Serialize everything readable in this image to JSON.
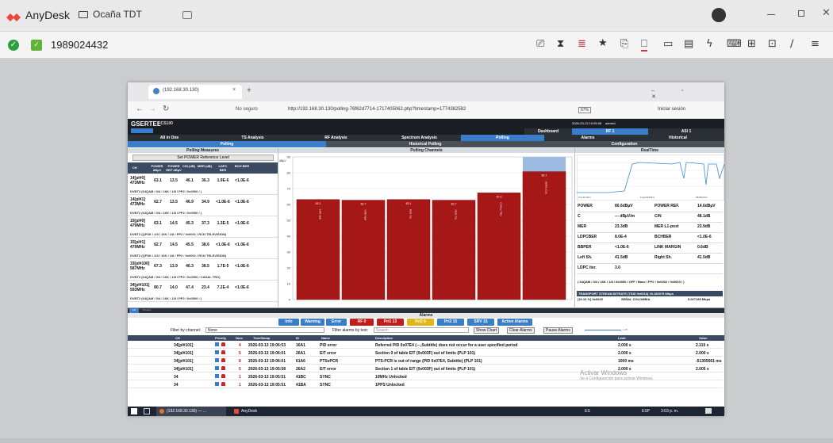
{
  "anydesk": {
    "app_name": "AnyDesk",
    "tab_label": "Ocaña TDT",
    "address": "1989024432"
  },
  "browser": {
    "tab_title": "(192.168.30.130)",
    "not_secure": "No seguro",
    "url": "http://192.168.30.130/polling-76f62d7714-1717405062.php?timestamp=1774382582",
    "zoom": "67%",
    "signin": "Iniciar sesión"
  },
  "gsertel": {
    "brand": "GSERTEL",
    "model": "RCS100",
    "datetime": "2026-03-13 19:06:08",
    "user": "admin1",
    "top_tabs": [
      "Dashboard",
      "RF 1",
      "ASI 1"
    ],
    "nav_items": [
      "All in One",
      "TS Analysis",
      "RF Analysis",
      "Spectrum Analysis",
      "Polling",
      "Alarms",
      "Historical"
    ],
    "sub_tabs": [
      "Polling",
      "Historical Polling",
      "Configuration"
    ],
    "polling_measures_title": "Polling Measures",
    "set_power_btn": "Set POWER Reference Level",
    "col_headers": [
      "CH",
      "POWER dBµV",
      "POWER REF dBµV",
      "C/N (dB)",
      "MER (dB)",
      "LDPC BER",
      "BCH BER"
    ],
    "channels": [
      {
        "name": "14[pl#0] 473MHz",
        "vals": [
          "63.1",
          "13.5",
          "46.1",
          "36.3",
          "1.9E-6",
          "<1.0E-6"
        ],
        "sub": "DVBT2 (64QAM / 3/4 / 16K / 1/8 / PP2 / 0x0000 / )"
      },
      {
        "name": "14[pl#1] 473MHz",
        "vals": [
          "62.7",
          "13.5",
          "46.9",
          "34.9",
          "<1.0E-6",
          "<1.0E-6"
        ],
        "sub": "DVBT2 (64QAM / 3/4 / 16K / 1/8 / PP2 / 0x0000 / )"
      },
      {
        "name": "15[pl#0] 479MHz",
        "vals": [
          "63.1",
          "14.5",
          "45.3",
          "37.3",
          "1.3E-5",
          "<1.0E-6"
        ],
        "sub": "DVBT2 (QPSK / 2/3 / 16K / 1/8 / PP2 / 0x0001 / RCN TELEVISION)"
      },
      {
        "name": "15[pl#1] 479MHz",
        "vals": [
          "62.7",
          "14.5",
          "45.5",
          "38.6",
          "<1.0E-6",
          "<1.0E-6"
        ],
        "sub": "DVBT2 (QPSK / 2/3 / 16K / 1/8 / PP2 / 0x0001 / RCN TELEVISION)"
      },
      {
        "name": "33[pl#100] 587MHz",
        "vals": [
          "67.3",
          "13.9",
          "46.3",
          "38.5",
          "1.7E-5",
          "<1.0E-6"
        ],
        "sub": "DVBT2 (64QAM / 3/4 / 16K / 1/8 / PP2 / 0x0000 / CANAL TRO)"
      },
      {
        "name": "34[pl#101] 593MHz",
        "vals": [
          "80.7",
          "14.0",
          "47.4",
          "23.4",
          "7.2E-4",
          "<1.0E-6"
        ],
        "sub": "DVBT2 (64QAM / 3/4 / 16K / 1/8 / PP2 / 0x0000 / )"
      }
    ],
    "polling_channels_title": "Polling Channels",
    "chart_data": {
      "type": "bar",
      "title": "Polling Channels",
      "categories": [
        "14[pl#0]",
        "14[pl#1]",
        "15[pl#0]",
        "15[pl#1]",
        "33[pl#100]",
        "34[pl#101]"
      ],
      "values": [
        63.1,
        62.7,
        63.1,
        62.7,
        67.3,
        80.7
      ],
      "bar_labels": [
        "63.1",
        "62.7",
        "63.1",
        "62.7",
        "67.3",
        "80.7"
      ],
      "value_labels": [
        "CRN 4b9f",
        "CRN 4b9f",
        "RCN TEL",
        "RCN TEL",
        "CANAL TRO",
        "SEÑAL COL"
      ],
      "ylim": [
        0,
        90
      ],
      "yticks": [
        "0",
        "10",
        "20",
        "30",
        "40",
        "50",
        "60",
        "70",
        "80",
        "90"
      ],
      "ylabel": "dBµV",
      "ref_band": 90
    },
    "realtime_title": "RealTime",
    "realtime_axis_left": "Pre/16 MHz",
    "realtime_axis_mid": "Freq/320MHz",
    "realtime_axis_right": "98dB/16Hz",
    "measures": [
      [
        "POWER",
        "80.6dBµV",
        "POWER REF.",
        "14.6dBµV"
      ],
      [
        "C",
        "--- dBµV/m",
        "C/N",
        "48.1dB"
      ],
      [
        "MER",
        "23.3dB",
        "MER L1-post",
        "23.9dB"
      ],
      [
        "LDPCBER",
        "8.0E-4",
        "BCHBER",
        "<1.0E-6"
      ],
      [
        "BBPER",
        "<1.0E-6",
        "LINK MARGIN",
        "0.6dB"
      ],
      [
        "Left Sh.",
        "41.5dB",
        "Right Sh.",
        "41.5dB"
      ],
      [
        "LDPC iter.",
        "3.0",
        "",
        ""
      ]
    ],
    "modulation": "( 64QAM / 3/4 / 16K / 1/8 / 0x0000 / OFF / Base / PP2 / 0x0002 / 0x0003 / )",
    "ts_bitrate_title": "TRANSPORT STREAM BITRATE (TSID 0x0013) 16.180075 Mbps",
    "ts_row": [
      "[16.10 %] 0x0025",
      "SEÑAL COLOMBIA",
      "5.027195 Mbps"
    ],
    "alarms_title": "Alarms",
    "alarm_tabs": [
      "List",
      "Timeline"
    ],
    "alarm_filters": {
      "info": "Info",
      "warning": "Warning",
      "error": "Error",
      "rf": "RF",
      "rf_count": "0",
      "pri1": "Pri1",
      "pri1_count": "13",
      "pri2": "Pri2",
      "pri2_count": "6",
      "pri3": "Pri3",
      "pri3_count": "15",
      "srv": "SRV",
      "srv_count": "15",
      "active": "Active Alarms"
    },
    "filter_channel_label": "Filter by channel:",
    "filter_channel_value": "None",
    "filter_text_label": "Filter alarms by text:",
    "filter_text_placeholder": "Search",
    "show_chart": "Show Chart",
    "clear_alarms": "Clear Alarms",
    "pause_alarms": "Pause Alarms",
    "alarm_headers": [
      "CH",
      "Priority",
      "Num",
      "TimeStamp",
      "ID",
      "Name",
      "Description",
      "Limit",
      "Value"
    ],
    "alarms": [
      {
        "ch": "34[pl#101]",
        "num": "4",
        "ts": "2026-03-13 19:06:53",
        "id": "16A1",
        "name": "PID error",
        "desc": "Referred PID 0x07E4 (---,Subtitle) does not occur for a user specified period",
        "limit": "2.000 s",
        "value": "2.110 s"
      },
      {
        "ch": "34[pl#101]",
        "num": "5",
        "ts": "2026-03-13 19:06:01",
        "id": "26A1",
        "name": "EIT error",
        "desc": "Section 0 of table EIT (0x003F) out of limits (PLP 101)",
        "limit": "2.000 s",
        "value": "2.000 s"
      },
      {
        "ch": "34[pl#101]",
        "num": "8",
        "ts": "2026-03-13 19:06:01",
        "id": "61A6",
        "name": "PTSvPCR",
        "desc": "PTS-PCR is out of range (PID 0x07E4, Subtitle) (PLP 101)",
        "limit": "1000 ms",
        "value": "-51305661 ms"
      },
      {
        "ch": "34[pl#101]",
        "num": "5",
        "ts": "2026-03-13 19:05:58",
        "id": "26A2",
        "name": "EIT error",
        "desc": "Section 1 of table EIT (0x003F) out of limits (PLP 101)",
        "limit": "2.000 s",
        "value": "2.005 s"
      },
      {
        "ch": "34",
        "num": "1",
        "ts": "2026-03-13 19:05:51",
        "id": "41BC",
        "name": "SYNC",
        "desc": "10MHz Unlocked",
        "limit": "",
        "value": ""
      },
      {
        "ch": "34",
        "num": "1",
        "ts": "2026-03-13 19:05:51",
        "id": "41BA",
        "name": "SYNC",
        "desc": "1PPS Unlocked",
        "limit": "",
        "value": ""
      }
    ],
    "watermark_title": "Activar Windows",
    "watermark_sub": "Ve a Configuración para activar Windows.",
    "slider_value": "1.25"
  },
  "taskbar": {
    "task1": "(192.168.30.130) — ...",
    "task2": "AnyDesk",
    "lang": "ES",
    "kbd": "ESP",
    "time": "3:03 p. m."
  }
}
